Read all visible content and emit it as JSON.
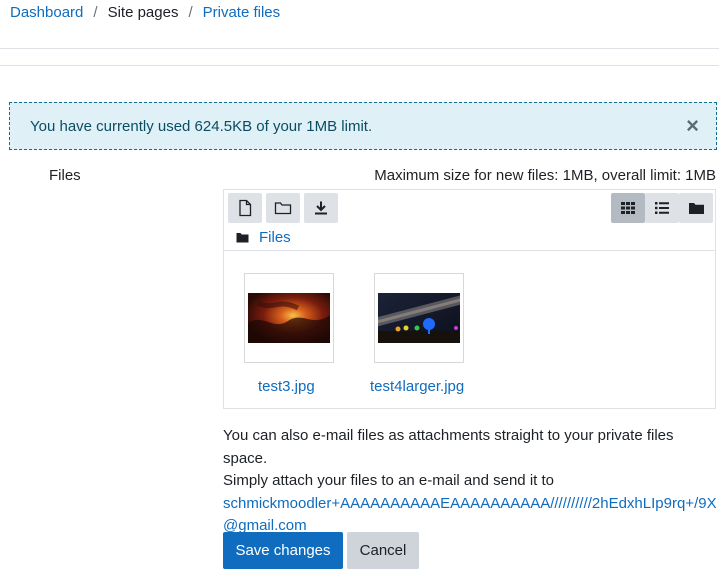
{
  "breadcrumb": {
    "items": [
      {
        "label": "Dashboard"
      },
      {
        "label": "Site pages"
      },
      {
        "label": "Private files"
      }
    ],
    "separator": "/"
  },
  "alert": {
    "message": "You have currently used 624.5KB of your 1MB limit.",
    "close_glyph": "×"
  },
  "files_section": {
    "label": "Files",
    "max_size": "Maximum size for new files: 1MB, overall limit: 1MB"
  },
  "filemanager": {
    "toolbar_left_icons": [
      "add-file-icon",
      "create-folder-icon",
      "download-icon"
    ],
    "toolbar_right_icons": [
      "icon-view-grid-icon",
      "list-view-icon",
      "tree-view-folder-icon"
    ],
    "path_label": "Files",
    "files": [
      {
        "name": "test3.jpg"
      },
      {
        "name": "test4larger.jpg"
      }
    ]
  },
  "info": {
    "line1": "You can also e-mail files as attachments straight to your private files space.",
    "line2": "Simply attach your files to an e-mail and send it to",
    "email": "schmickmoodler+AAAAAAAAAAEAAAAAAAAAA//////////2hEdxhLIp9rq+/9X@gmail.com"
  },
  "buttons": {
    "save": "Save changes",
    "cancel": "Cancel"
  },
  "colors": {
    "link": "#0f6cbf",
    "primary": "#0f6cbf",
    "alert_bg": "#dff0f6"
  }
}
